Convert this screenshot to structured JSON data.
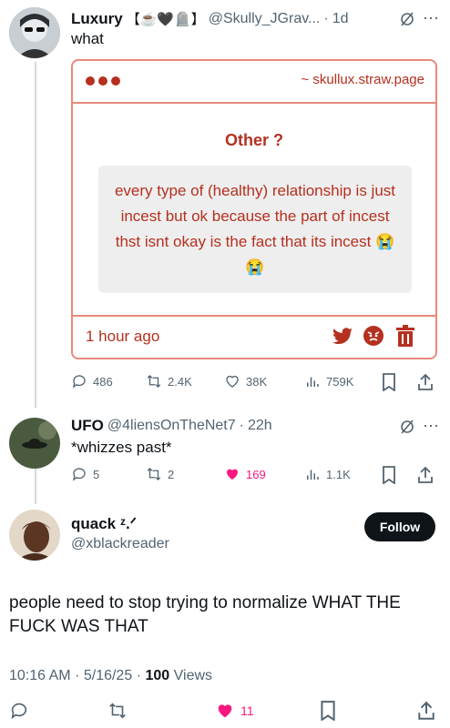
{
  "reply1": {
    "author_name": "Luxury",
    "author_decor": "【☕🖤🪦】",
    "handle": "@Skully_JGrav...",
    "dot": "·",
    "time": "1d",
    "text": "what",
    "card": {
      "url": "~ skullux.straw.page",
      "title": "Other ?",
      "message": "every type of (healthy) relationship is just incest but ok because the part of incest thst isnt okay is the fact that its incest 😭😭",
      "timestamp": "1 hour ago"
    },
    "stats": {
      "replies": "486",
      "reposts": "2.4K",
      "likes": "38K",
      "views": "759K"
    }
  },
  "reply2": {
    "author_name": "UFO",
    "handle": "@4liensOnTheNet7",
    "dot": "·",
    "time": "22h",
    "text": "*whizzes past*",
    "stats": {
      "replies": "5",
      "reposts": "2",
      "likes": "169",
      "views": "1.1K"
    }
  },
  "main": {
    "author_name": "quack ᶻ.ᐟ",
    "handle": "@xblackreader",
    "follow_label": "Follow",
    "text": "people need to stop trying to normalize WHAT THE FUCK WAS THAT",
    "time": "10:16 AM",
    "date": "5/16/25",
    "views_count": "100",
    "views_label": "Views",
    "likes": "11"
  },
  "colors": {
    "accent_card": "#b5301f",
    "like_pink": "#f91880",
    "text_muted": "#536471"
  }
}
